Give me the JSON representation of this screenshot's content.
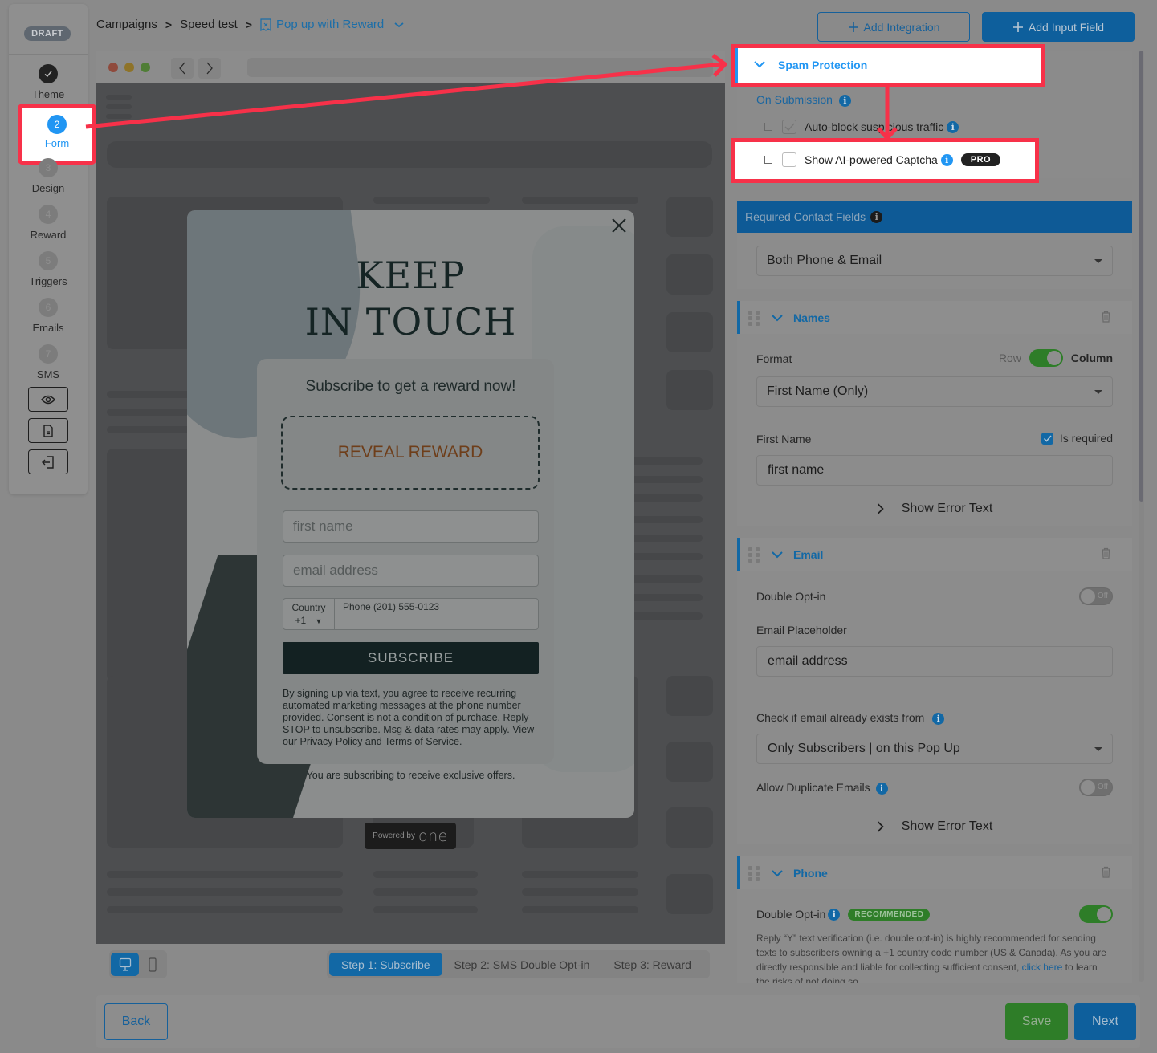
{
  "stepper": {
    "status_badge": "DRAFT",
    "steps": [
      {
        "number": "✓",
        "label": "Theme",
        "state": "done"
      },
      {
        "number": "2",
        "label": "Form",
        "state": "active"
      },
      {
        "number": "3",
        "label": "Design",
        "state": "pending"
      },
      {
        "number": "4",
        "label": "Reward",
        "state": "pending"
      },
      {
        "number": "5",
        "label": "Triggers",
        "state": "pending"
      },
      {
        "number": "6",
        "label": "Emails",
        "state": "pending"
      },
      {
        "number": "7",
        "label": "SMS",
        "state": "pending"
      }
    ],
    "tools": [
      "eye-icon",
      "document-icon",
      "exit-icon"
    ]
  },
  "breadcrumb": {
    "items": [
      "Campaigns",
      "Speed test"
    ],
    "separator": ">",
    "current": "Pop up with Reward"
  },
  "toolbar": {
    "add_integration": "Add Integration",
    "add_input_field": "Add Input Field"
  },
  "preview": {
    "headline_line1": "KEEP",
    "headline_line2": "IN TOUCH",
    "subhead": "Subscribe to get a reward now!",
    "reveal_label": "REVEAL REWARD",
    "first_name_placeholder": "first name",
    "email_placeholder": "email address",
    "country_label": "Country",
    "country_code": "+1",
    "phone_placeholder": "Phone (201) 555-0123",
    "subscribe_label": "SUBSCRIBE",
    "legal_text": "By signing up via text, you agree to receive recurring automated marketing messages at the phone number provided. Consent is not a condition of purchase. Reply STOP to unsubscribe. Msg & data rates may apply. View our Privacy Policy and Terms of Service.",
    "exclusive_text": "You are subscribing to receive exclusive offers.",
    "powered_by": "Powered by",
    "powered_brand": "one",
    "step_tabs": [
      "Step 1: Subscribe",
      "Step 2: SMS Double Opt-in",
      "Step 3: Reward"
    ],
    "active_step_tab": 0,
    "device": "desktop"
  },
  "settings": {
    "spam": {
      "title": "Spam Protection",
      "on_submission": "On Submission",
      "auto_block_label": "Auto-block suspicious traffic",
      "auto_block_checked": true,
      "captcha_label": "Show AI-powered Captcha",
      "captcha_checked": false,
      "captcha_badge": "PRO"
    },
    "required_contact": {
      "title": "Required Contact Fields",
      "value": "Both Phone & Email"
    },
    "names": {
      "title": "Names",
      "format_label": "Format",
      "format_row": "Row",
      "format_column": "Column",
      "format_is_column": true,
      "format_value": "First Name (Only)",
      "first_name_label": "First Name",
      "is_required_label": "Is required",
      "is_required": true,
      "first_name_value": "first name",
      "show_error": "Show Error Text"
    },
    "email": {
      "title": "Email",
      "double_optin_label": "Double Opt-in",
      "double_optin_state": "Off",
      "placeholder_label": "Email Placeholder",
      "placeholder_value": "email address",
      "check_exists_label": "Check if email already exists from",
      "check_exists_value": "Only Subscribers | on this Pop Up",
      "allow_duplicates_label": "Allow Duplicate Emails",
      "allow_duplicates_state": "Off",
      "show_error": "Show Error Text"
    },
    "phone": {
      "title": "Phone",
      "double_optin_label": "Double Opt-in",
      "recommended_badge": "RECOMMENDED",
      "double_optin_on": true,
      "description_before_link": "Reply “Y” text verification (i.e. double opt-in) is highly recommended for sending texts to subscribers owning a +1 country code number (US & Canada). As you are directly responsible and liable for collecting sufficient consent, ",
      "link_text": "click here",
      "description_after_link": " to learn the risks of not doing so."
    }
  },
  "footer": {
    "back": "Back",
    "save": "Save",
    "next": "Next"
  },
  "colors": {
    "accent_blue": "#2196f3",
    "primary_blue": "#1268a5",
    "save_green": "#2e7d28",
    "annotation_red": "#f73149"
  }
}
